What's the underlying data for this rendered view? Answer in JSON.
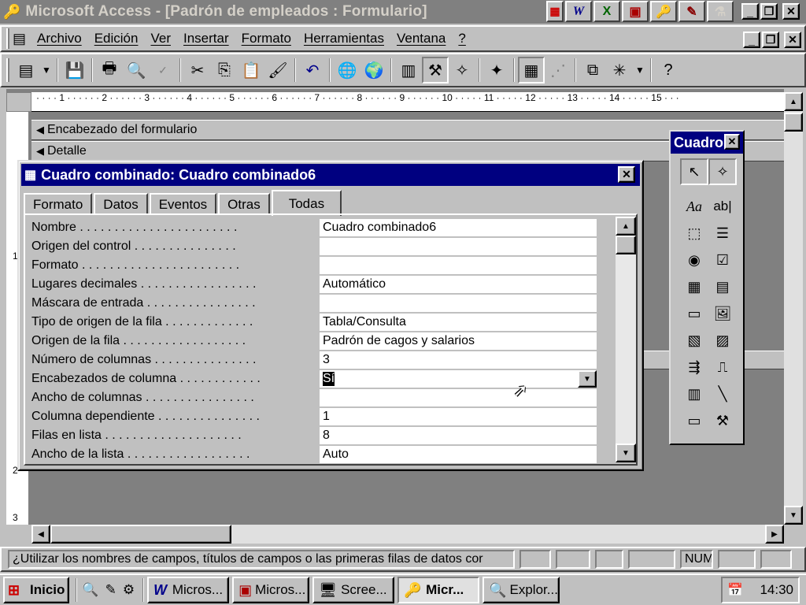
{
  "app": {
    "title": "Microsoft Access - [Padrón de empleados : Formulario]"
  },
  "title_icons": [
    "word-icon",
    "excel-icon",
    "powerpoint-icon",
    "access-icon",
    "schedule-icon",
    "binder-icon"
  ],
  "menu": {
    "items": [
      "Archivo",
      "Edición",
      "Ver",
      "Insertar",
      "Formato",
      "Herramientas",
      "Ventana",
      "?"
    ]
  },
  "ruler": {
    "marks": [
      "1",
      "2",
      "3",
      "4",
      "5",
      "6",
      "7",
      "8",
      "9",
      "10",
      "11",
      "12",
      "13",
      "14",
      "15"
    ],
    "vmarks": [
      "1",
      "2",
      "3"
    ]
  },
  "form": {
    "header_section": "Encabezado del formulario",
    "detail_section": "Detalle"
  },
  "property_sheet": {
    "title": "Cuadro combinado: Cuadro combinado6",
    "tabs": [
      "Formato",
      "Datos",
      "Eventos",
      "Otras",
      "Todas"
    ],
    "active_tab": "Todas",
    "rows": [
      {
        "label": "Nombre . . . . . . . . . . . . . . . . . . . . . . .",
        "value": "Cuadro combinado6"
      },
      {
        "label": "Origen del control . . . . . . . . . . . . . . .",
        "value": ""
      },
      {
        "label": "Formato . . . . . . . . . . . . . . . . . . . . . . .",
        "value": ""
      },
      {
        "label": "Lugares decimales . . . . . . . . . . . . . . . . .",
        "value": "Automático"
      },
      {
        "label": "Máscara de entrada . . . . . . . . . . . . . . . .",
        "value": ""
      },
      {
        "label": "Tipo de origen de la fila . . . . . . . . . . . . .",
        "value": "Tabla/Consulta"
      },
      {
        "label": "Origen de la fila . . . . . . . . . . . . . . . . . .",
        "value": "Padrón de cagos y salarios"
      },
      {
        "label": "Número de columnas . . . . . . . . . . . . . . .",
        "value": "3"
      },
      {
        "label": "Encabezados de columna . . . . . . . . . . . .",
        "value": "Sí"
      },
      {
        "label": "Ancho de columnas . . . . . . . . . . . . . . . .",
        "value": ""
      },
      {
        "label": "Columna dependiente . . . . . . . . . . . . . . .",
        "value": "1"
      },
      {
        "label": "Filas en lista . . . . . . . . . . . . . . . . . . . .",
        "value": "8"
      },
      {
        "label": "Ancho de la lista . . . . . . . . . . . . . . . . . .",
        "value": "Auto"
      }
    ]
  },
  "toolbox": {
    "title": "Cuadro",
    "tools": [
      "select-icon",
      "wizard-icon",
      "label-icon",
      "textbox-icon",
      "option-group-icon",
      "toggle-icon",
      "option-button-icon",
      "checkbox-icon",
      "combo-box-icon",
      "list-box-icon",
      "command-button-icon",
      "image-icon",
      "unbound-frame-icon",
      "bound-frame-icon",
      "page-break-icon",
      "tab-control-icon",
      "subform-icon",
      "line-icon",
      "rectangle-icon",
      "more-controls-icon"
    ],
    "glyph_text": {
      "label": "Aa",
      "textbox": "ab|"
    }
  },
  "status": {
    "message": "¿Utilizar los nombres de campos, títulos de campos o las primeras filas de datos cor",
    "num": "NUM"
  },
  "taskbar": {
    "start": "Inicio",
    "tasks": [
      "Micros...",
      "Micros...",
      "Scree...",
      "Micr...",
      "Explor..."
    ],
    "active_task": 3,
    "clock": "14:30"
  }
}
